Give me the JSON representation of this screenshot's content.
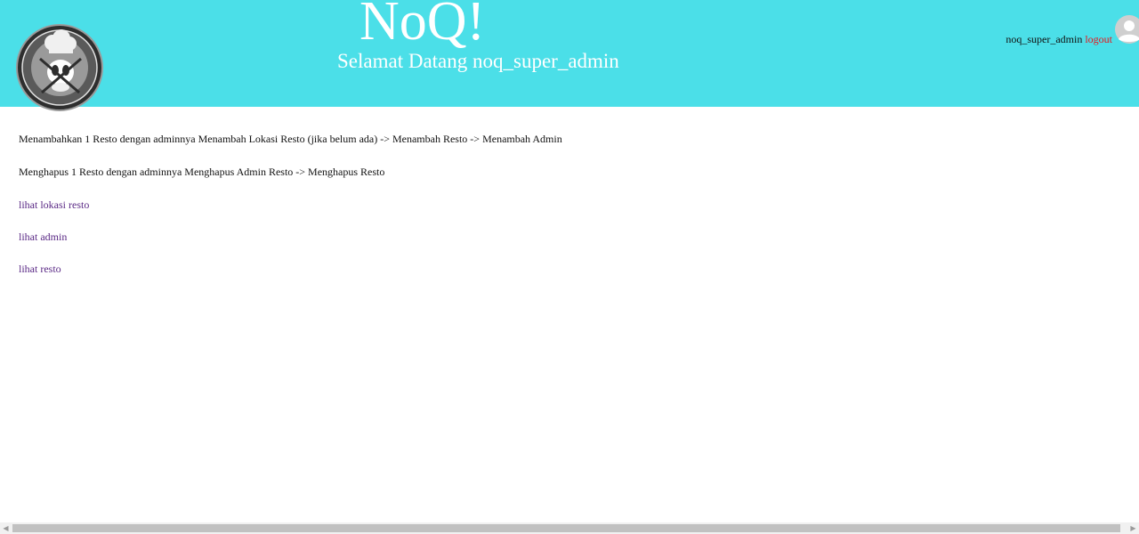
{
  "header": {
    "brand": "NoQ!",
    "welcome": "Selamat Datang noq_super_admin",
    "username": "noq_super_admin",
    "logout_label": "logout",
    "background_color": "#4bdfe8"
  },
  "main": {
    "instructions": [
      "Menambahkan 1 Resto dengan adminnya Menambah Lokasi Resto (jika belum ada) -> Menambah Resto -> Menambah Admin",
      "Menghapus 1 Resto dengan adminnya Menghapus Admin Resto -> Menghapus Resto"
    ],
    "links": [
      "lihat lokasi resto",
      "lihat admin",
      "lihat resto"
    ]
  },
  "icons": {
    "logo": "chef-hat-logo-icon",
    "avatar": "user-avatar-icon",
    "scroll_left": "chevron-left-icon",
    "scroll_right": "chevron-right-icon"
  }
}
